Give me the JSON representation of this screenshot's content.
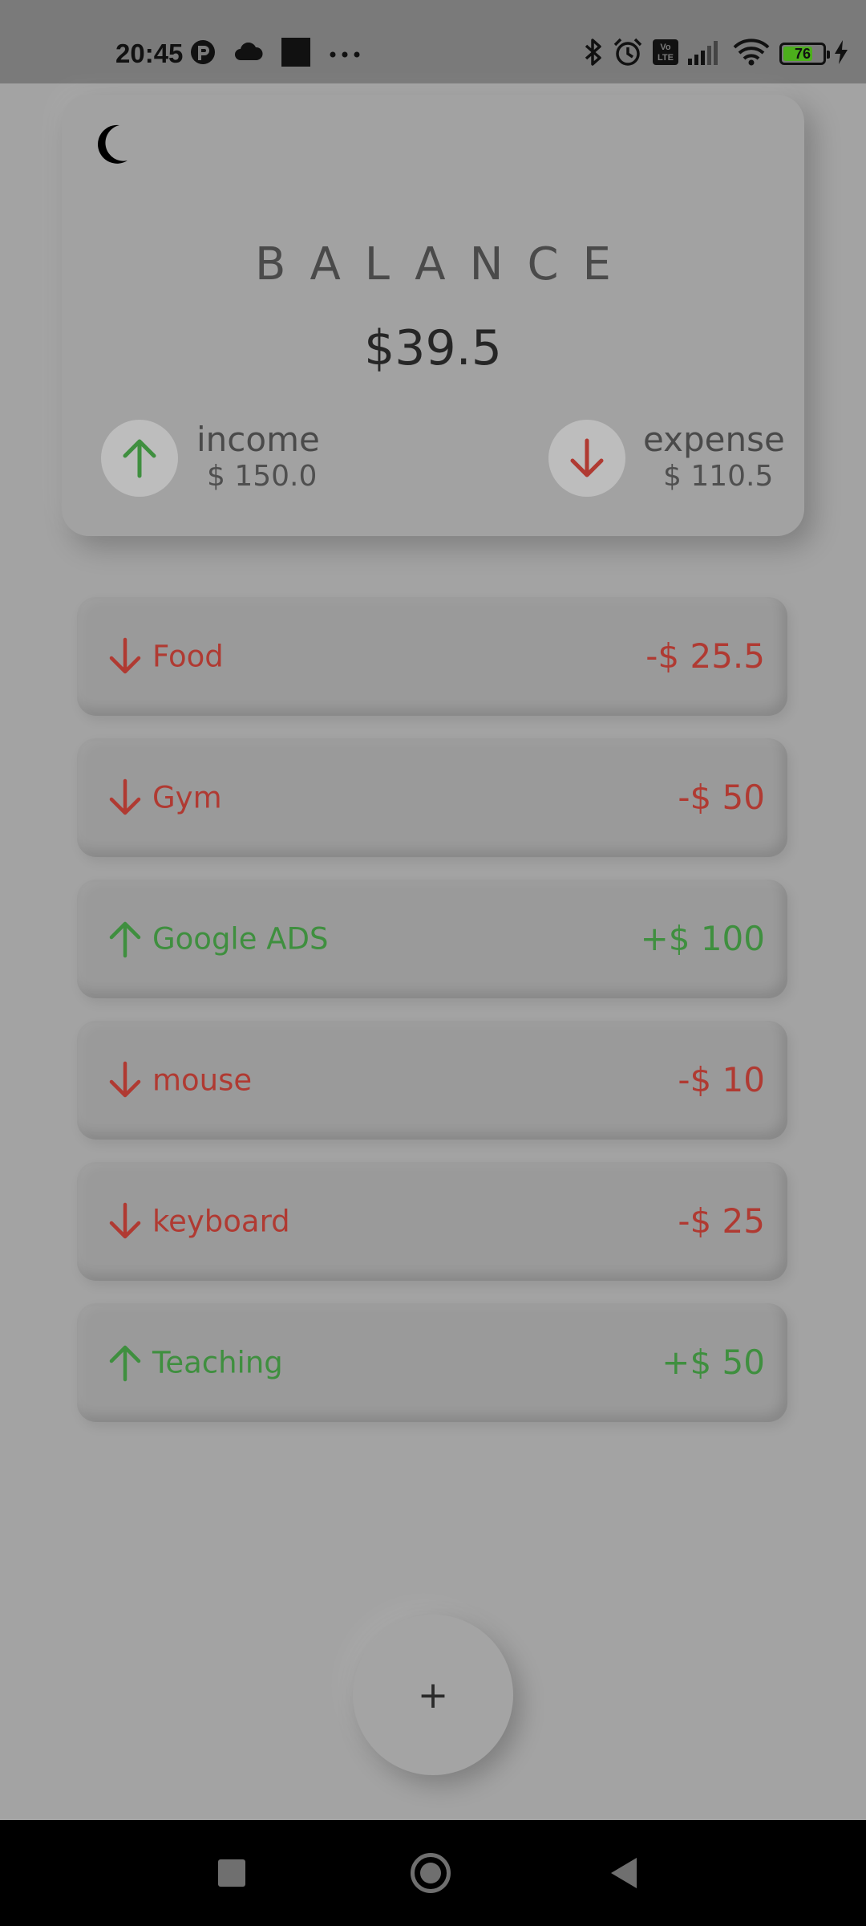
{
  "status_bar": {
    "time": "20:45",
    "left_icons": [
      "app-notification-icon",
      "cloud-icon",
      "square-icon",
      "more-icon"
    ],
    "right_icons": [
      "bluetooth-icon",
      "alarm-icon",
      "volte-icon",
      "signal-icon",
      "wifi-icon",
      "battery-icon",
      "charging-icon"
    ],
    "volte_label": "Vo\nLTE",
    "battery_percent": "76",
    "battery_level": 0.76
  },
  "header": {
    "theme_icon": "moon-icon"
  },
  "balance": {
    "title": "BALANCE",
    "amount": "$39.5",
    "income_label": "income",
    "income_value": "$ 150.0",
    "expense_label": "expense",
    "expense_value": "$ 110.5"
  },
  "transactions": [
    {
      "name": "Food",
      "amount": "-$ 25.5",
      "type": "expense"
    },
    {
      "name": "Gym",
      "amount": "-$ 50",
      "type": "expense"
    },
    {
      "name": "Google ADS",
      "amount": "+$ 100",
      "type": "income"
    },
    {
      "name": "mouse",
      "amount": "-$ 10",
      "type": "expense"
    },
    {
      "name": "keyboard",
      "amount": "-$ 25",
      "type": "expense"
    },
    {
      "name": "Teaching",
      "amount": "+$ 50",
      "type": "income"
    }
  ],
  "fab": {
    "label": "+"
  },
  "colors": {
    "income": "#3f8f3f",
    "expense": "#b03a32",
    "background": "#a3a3a3",
    "card": "#a2a2a2"
  }
}
